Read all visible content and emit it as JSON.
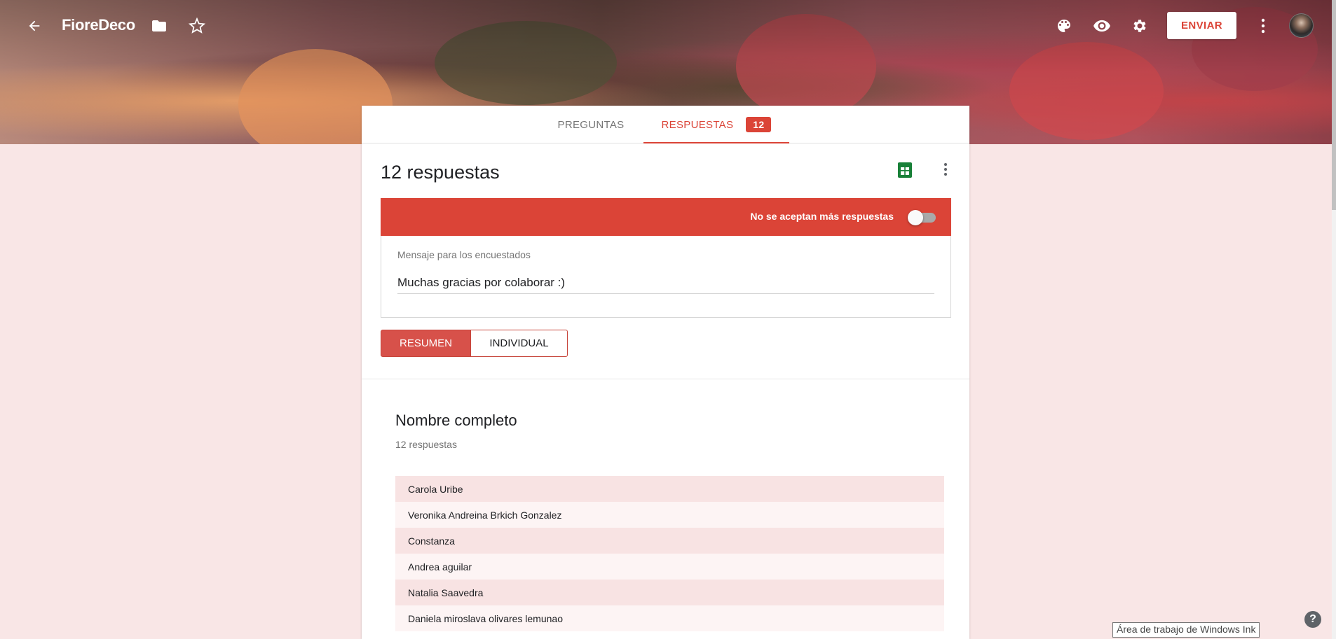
{
  "header": {
    "title": "FioreDeco",
    "send_label": "ENVIAR",
    "icons": [
      "back-arrow-icon",
      "folder-icon",
      "star-icon",
      "palette-icon",
      "eye-icon",
      "gear-icon",
      "more-vert-icon"
    ]
  },
  "tabs": [
    {
      "label": "PREGUNTAS",
      "active": false
    },
    {
      "label": "RESPUESTAS",
      "active": true,
      "badge": "12"
    }
  ],
  "responses": {
    "title": "12 respuestas",
    "accept_label": "No se aceptan más respuestas",
    "accepting": false,
    "message_label": "Mensaje para los encuestados",
    "message_value": "Muchas gracias por colaborar :)",
    "view_toggle": {
      "summary": "RESUMEN",
      "individual": "INDIVIDUAL",
      "selected": "RESUMEN"
    }
  },
  "question": {
    "title": "Nombre completo",
    "count": "12 respuestas",
    "answers": [
      "Carola Uribe",
      "Veronika Andreina Brkich Gonzalez",
      "Constanza",
      "Andrea aguilar",
      "Natalia Saavedra",
      "Daniela miroslava olivares lemunao"
    ]
  },
  "taskbar": {
    "ink_tooltip": "Área de trabajo de Windows Ink",
    "help": "?"
  },
  "colors": {
    "accent": "#db4437",
    "background": "#f9e6e6",
    "row_odd": "#f8e3e3",
    "row_even": "#fdf4f4"
  }
}
